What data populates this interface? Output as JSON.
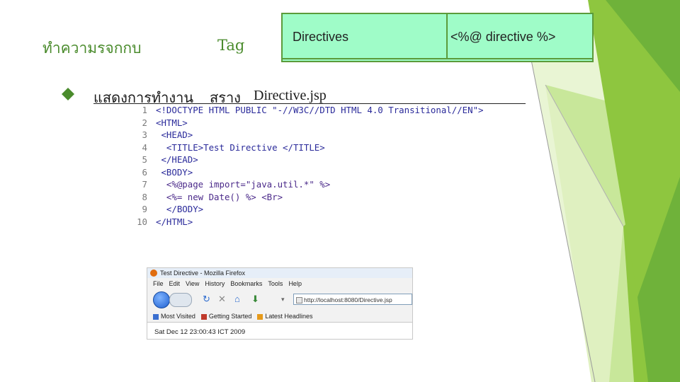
{
  "slide": {
    "title_left": "ทำความรจกกบ",
    "title_tag": "Tag",
    "bullet_text": "แสดงการทำงาน",
    "bullet_verb": "สราง",
    "bullet_file": "Directive.jsp"
  },
  "directives_table": {
    "col1": "Directives",
    "col2": "<%@ directive %>"
  },
  "code": {
    "lines": [
      {
        "n": "1",
        "text": "<!DOCTYPE HTML PUBLIC \"-//W3C//DTD HTML 4.0 Transitional//EN\">"
      },
      {
        "n": "2",
        "text": "<HTML>"
      },
      {
        "n": "3",
        "text": " <HEAD>"
      },
      {
        "n": "4",
        "text": "  <TITLE>Test Directive </TITLE>"
      },
      {
        "n": "5",
        "text": " </HEAD>"
      },
      {
        "n": "6",
        "text": " <BODY>"
      },
      {
        "n": "7",
        "text": "  <%@page import=\"java.util.*\" %>"
      },
      {
        "n": "8",
        "text": "  <%= new Date() %> <Br>"
      },
      {
        "n": "9",
        "text": "  </BODY>"
      },
      {
        "n": "10",
        "text": "</HTML>"
      }
    ]
  },
  "browser": {
    "window_title": "Test Directive - Mozilla Firefox",
    "menu": [
      "File",
      "Edit",
      "View",
      "History",
      "Bookmarks",
      "Tools",
      "Help"
    ],
    "url": "http://localhost:8080/Directive.jsp",
    "bookmarks": [
      "Most Visited",
      "Getting Started",
      "Latest Headlines"
    ],
    "content": "Sat Dec 12 23:00:43 ICT 2009"
  },
  "colors": {
    "accent_green": "#4a8b2c",
    "table_fill": "#9ffcc8",
    "facet_light": "#c8e79a",
    "facet_mid": "#8ec63f",
    "facet_dark": "#5a9a2a"
  }
}
